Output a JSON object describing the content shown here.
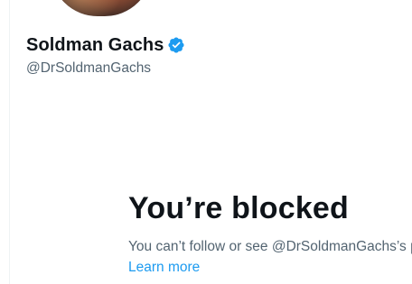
{
  "profile": {
    "display_name": "Soldman Gachs",
    "handle": "@DrSoldmanGachs",
    "verified_icon": "verified-badge-icon",
    "avatar": "profile-avatar"
  },
  "blocked": {
    "title": "You’re blocked",
    "description": "You can’t follow or see @DrSoldmanGachs’s posts.",
    "learn_more": "Learn more"
  },
  "colors": {
    "text_primary": "#0f1419",
    "text_secondary": "#536471",
    "link": "#1d9bf0",
    "verified": "#1d9bf0"
  }
}
